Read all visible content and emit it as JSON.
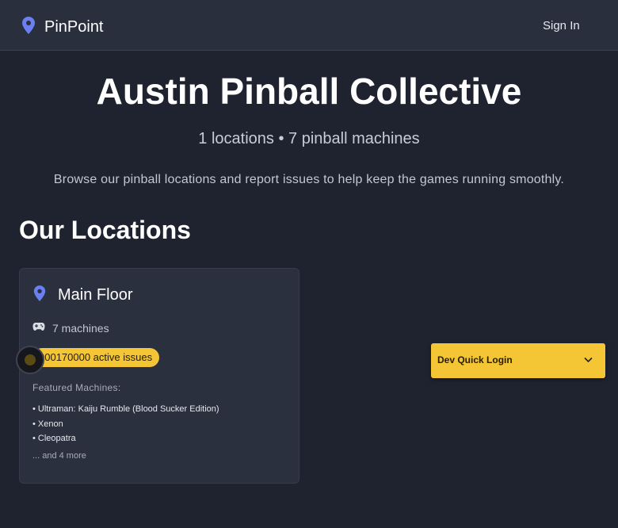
{
  "header": {
    "brand": "PinPoint",
    "sign_in": "Sign In"
  },
  "hero": {
    "title": "Austin Pinball Collective",
    "stats": "1 locations • 7 pinball machines",
    "description": "Browse our pinball locations and report issues to help keep the games running smoothly."
  },
  "locations": {
    "heading": "Our Locations",
    "cards": [
      {
        "name": "Main Floor",
        "machines_count": "7 machines",
        "issues_badge": "000170000 active issues",
        "featured_label": "Featured Machines:",
        "featured": [
          "• Ultraman: Kaiju Rumble (Blood Sucker Edition)",
          "• Xenon",
          "• Cleopatra"
        ],
        "more": "... and 4 more"
      }
    ]
  },
  "dev_login": {
    "label": "Dev Quick Login"
  },
  "colors": {
    "background": "#1f2330",
    "header": "#2a2f3d",
    "card": "#2b303e",
    "accent_icon": "#6b7ff0",
    "badge": "#f4c534"
  },
  "icons": {
    "brand": "map-pin-icon",
    "location": "map-pin-icon",
    "machines": "gamepad-icon",
    "dropdown": "chevron-down-icon"
  }
}
